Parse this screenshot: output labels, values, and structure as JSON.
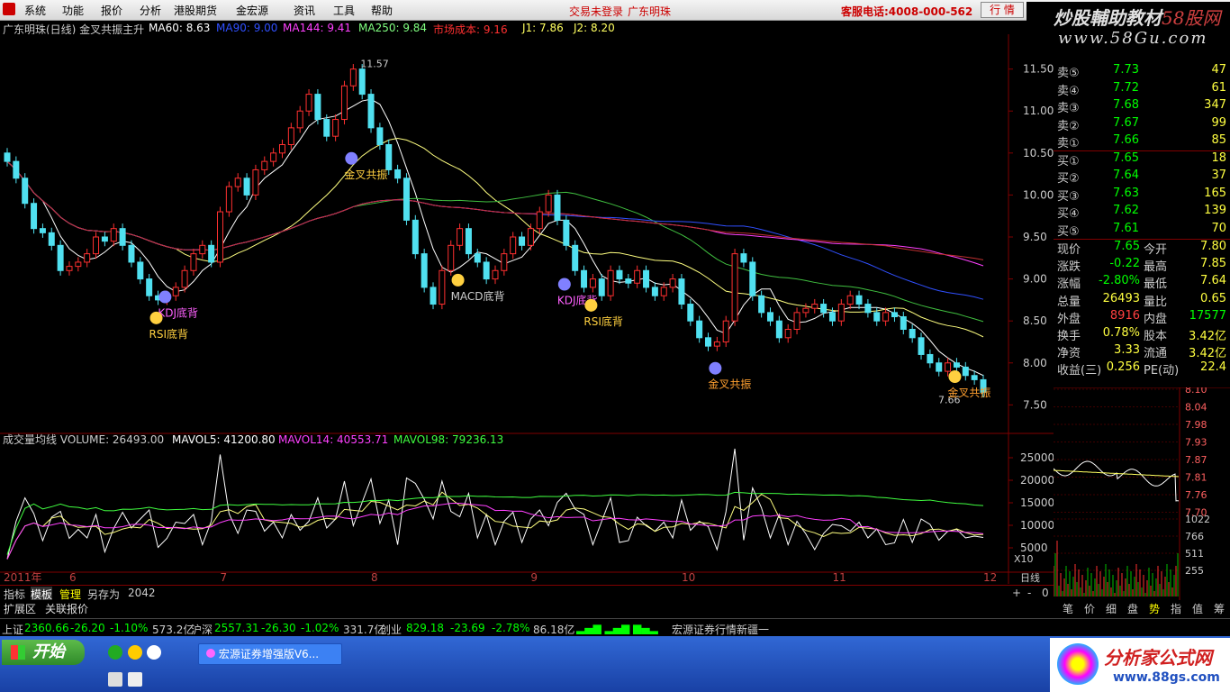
{
  "menu": {
    "items": [
      "系统",
      "功能",
      "报价",
      "分析",
      "港股期货",
      "金宏源",
      "资讯",
      "工具",
      "帮助"
    ],
    "login_status": "交易未登录",
    "stock": "广东明珠",
    "hotline": "客服电话:4008-000-562",
    "quote_button": "行 情"
  },
  "watermark": {
    "line1a": "炒股輔助教材",
    "line1b": "58股网",
    "line2": "www.58Gu.com"
  },
  "title_bar": {
    "name": "广东明珠(日线) 金叉共振主升",
    "ma60": "MA60: 8.63",
    "ma_hidden": "MA90: 9.00",
    "ma144": "MA144: 9.41",
    "ma250": "MA250: 9.84",
    "cost": "市场成本: 9.16",
    "j1": "J1: 7.86",
    "j2": "J2: 8.20"
  },
  "chart_data": {
    "type": "candlestick",
    "price_axis": [
      "11.50",
      "11.00",
      "10.50",
      "10.00",
      "9.50",
      "9.00",
      "8.50",
      "8.00",
      "7.50"
    ],
    "ylim": [
      7.3,
      11.7
    ],
    "high_label": "11.57",
    "low_label": "7.66",
    "months": [
      "2011年",
      "6",
      "7",
      "8",
      "9",
      "10",
      "11",
      "12"
    ],
    "annotations": [
      "KDJ底背",
      "RSI底背",
      "金叉共振",
      "MACD底背",
      "KDJ底背",
      "RSI底背",
      "金叉共振",
      "金叉共振"
    ],
    "volume_title": "成交量均线 VOLUME: 26493.00",
    "mavol5": "MAVOL5: 41200.80",
    "mavol14": "MAVOL14: 40553.71",
    "mavol98": "MAVOL98: 79236.13",
    "volume_axis": [
      "25000",
      "20000",
      "15000",
      "10000",
      "5000"
    ],
    "volume_unit": "X10",
    "close": [
      10.4,
      10.2,
      9.9,
      9.6,
      9.55,
      9.4,
      9.1,
      9.15,
      9.2,
      9.3,
      9.5,
      9.45,
      9.6,
      9.4,
      9.2,
      9.0,
      8.8,
      8.75,
      8.8,
      8.9,
      9.1,
      9.3,
      9.4,
      9.2,
      9.8,
      10.1,
      10.2,
      10.0,
      10.3,
      10.4,
      10.5,
      10.6,
      10.8,
      11.0,
      11.2,
      10.9,
      10.7,
      10.9,
      11.3,
      11.5,
      11.2,
      10.8,
      10.6,
      10.3,
      10.2,
      9.7,
      9.3,
      8.9,
      8.7,
      9.1,
      9.4,
      9.6,
      9.3,
      9.2,
      9.0,
      9.1,
      9.3,
      9.5,
      9.4,
      9.6,
      9.8,
      10.0,
      9.7,
      9.4,
      9.1,
      8.9,
      9.0,
      8.8,
      9.1,
      9.0,
      8.95,
      9.1,
      8.9,
      8.8,
      8.9,
      9.0,
      8.7,
      8.5,
      8.3,
      8.2,
      8.25,
      8.5,
      9.3,
      9.2,
      8.8,
      8.6,
      8.5,
      8.3,
      8.4,
      8.6,
      8.65,
      8.7,
      8.6,
      8.5,
      8.7,
      8.8,
      8.7,
      8.6,
      8.5,
      8.6,
      8.55,
      8.4,
      8.3,
      8.1,
      8.0,
      7.9,
      8.0,
      7.95,
      7.85,
      7.8,
      7.65
    ]
  },
  "order_book": {
    "sell": [
      {
        "label": "卖⑤",
        "price": "7.73",
        "vol": "47"
      },
      {
        "label": "卖④",
        "price": "7.72",
        "vol": "61"
      },
      {
        "label": "卖③",
        "price": "7.68",
        "vol": "347"
      },
      {
        "label": "卖②",
        "price": "7.67",
        "vol": "99"
      },
      {
        "label": "卖①",
        "price": "7.66",
        "vol": "85"
      }
    ],
    "buy": [
      {
        "label": "买①",
        "price": "7.65",
        "vol": "18"
      },
      {
        "label": "买②",
        "price": "7.64",
        "vol": "37"
      },
      {
        "label": "买③",
        "price": "7.63",
        "vol": "165"
      },
      {
        "label": "买④",
        "price": "7.62",
        "vol": "139"
      },
      {
        "label": "买⑤",
        "price": "7.61",
        "vol": "70"
      }
    ]
  },
  "stats": [
    {
      "l1": "现价",
      "v1": "7.65",
      "l2": "今开",
      "v2": "7.80"
    },
    {
      "l1": "涨跌",
      "v1": "-0.22",
      "l2": "最高",
      "v2": "7.85"
    },
    {
      "l1": "涨幅",
      "v1": "-2.80%",
      "l2": "最低",
      "v2": "7.64"
    },
    {
      "l1": "总量",
      "v1": "26493",
      "l2": "量比",
      "v2": "0.65"
    },
    {
      "l1": "外盘",
      "v1": "8916",
      "l2": "内盘",
      "v2": "17577"
    },
    {
      "l1": "换手",
      "v1": "0.78%",
      "l2": "股本",
      "v2": "3.42亿"
    },
    {
      "l1": "净资",
      "v1": "3.33",
      "l2": "流通",
      "v2": "3.42亿"
    },
    {
      "l1": "收益(三)",
      "v1": "0.256",
      "l2": "PE(动)",
      "v2": "22.4"
    }
  ],
  "mini_axis": [
    "8.10",
    "8.04",
    "7.98",
    "7.93",
    "7.87",
    "7.81",
    "7.76",
    "7.70",
    "1022",
    "766",
    "511",
    "255"
  ],
  "bottom_tabs": [
    "指标",
    "模板",
    "管理",
    "另存为",
    "2042"
  ],
  "ext_tabs": [
    "扩展区",
    "关联报价"
  ],
  "period_label": "日线",
  "right_tabs": [
    "笔",
    "价",
    "细",
    "盘",
    "势",
    "指",
    "值",
    "筹"
  ],
  "ticker": {
    "sh": {
      "name": "上证",
      "val": "2360.66",
      "chg": "-26.20",
      "pct": "-1.10%",
      "amt": "573.2亿"
    },
    "sz": {
      "name": "沪深",
      "val": "2557.31",
      "chg": "-26.30",
      "pct": "-1.02%",
      "amt": "331.7亿"
    },
    "cy": {
      "name": "创业",
      "val": "829.18",
      "chg": "-23.69",
      "pct": "-2.78%",
      "amt": "86.18亿"
    },
    "news": "宏源证券行情新疆一"
  },
  "taskbar": {
    "start": "开始",
    "app": "宏源证券增强版V6..."
  },
  "brand": {
    "t1": "分析家公式网",
    "t2": "www.88gs.com"
  }
}
